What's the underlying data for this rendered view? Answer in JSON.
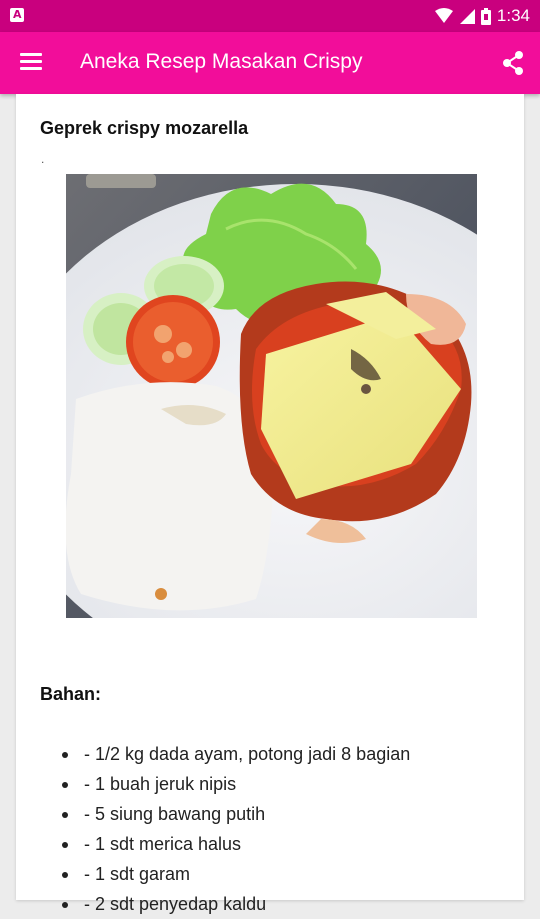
{
  "status_bar": {
    "time": "1:34"
  },
  "app_bar": {
    "title": "Aneka Resep Masakan Crispy"
  },
  "recipe": {
    "title": "Geprek crispy mozarella",
    "separator": ".",
    "image_alt": "Geprek crispy mozarella",
    "section_label": "Bahan:",
    "ingredients": [
      "- 1/2 kg dada ayam, potong jadi 8 bagian",
      "- 1 buah jeruk nipis",
      "- 5 siung bawang putih",
      "- 1 sdt merica halus",
      "- 1 sdt garam",
      "- 2 sdt penyedap kaldu"
    ]
  },
  "colors": {
    "status_bar": "#c9007e",
    "app_bar": "#f20d9a"
  },
  "icons": {
    "menu": "menu-icon",
    "share": "share-icon"
  }
}
